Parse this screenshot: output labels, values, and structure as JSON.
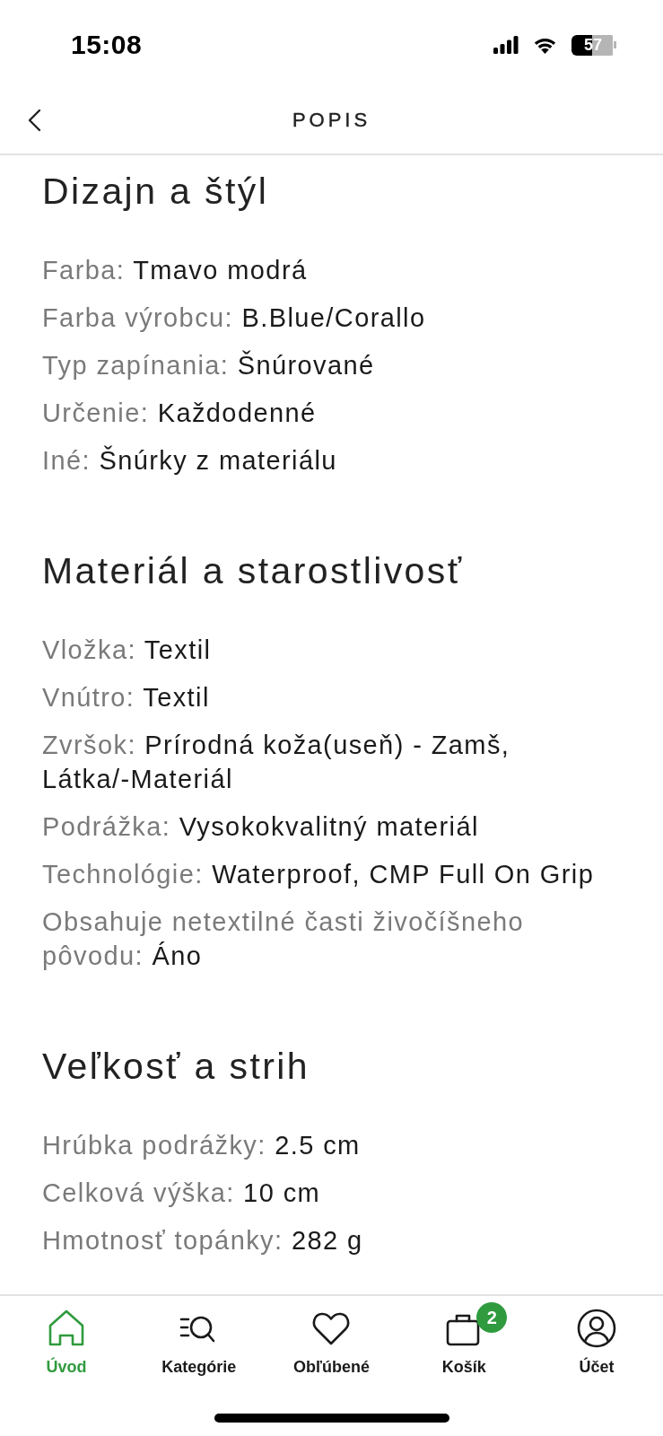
{
  "status_bar": {
    "time": "15:08",
    "battery": "57"
  },
  "header": {
    "title": "POPIS"
  },
  "sections": [
    {
      "title": "Dizajn a štýl",
      "attributes": [
        {
          "label": "Farba:",
          "value": "Tmavo modrá"
        },
        {
          "label": "Farba výrobcu:",
          "value": "B.Blue/Corallo"
        },
        {
          "label": "Typ zapínania:",
          "value": "Šnúrované"
        },
        {
          "label": "Určenie:",
          "value": "Každodenné"
        },
        {
          "label": "Iné:",
          "value": "Šnúrky z materiálu"
        }
      ]
    },
    {
      "title": "Materiál a starostlivosť",
      "attributes": [
        {
          "label": "Vložka:",
          "value": "Textil"
        },
        {
          "label": "Vnútro:",
          "value": "Textil"
        },
        {
          "label": "Zvršok:",
          "value": "Prírodná koža(useň) - Zamš, Látka/-Materiál"
        },
        {
          "label": "Podrážka:",
          "value": "Vysokokvalitný materiál"
        },
        {
          "label": "Technológie:",
          "value": "Waterproof, CMP Full On Grip"
        },
        {
          "label": "Obsahuje netextilné časti živočíšneho pôvodu:",
          "value": "Áno"
        }
      ]
    },
    {
      "title": "Veľkosť a strih",
      "attributes": [
        {
          "label": "Hrúbka podrážky:",
          "value": "2.5 cm"
        },
        {
          "label": "Celková výška:",
          "value": "10 cm"
        },
        {
          "label": "Hmotnosť topánky:",
          "value": "282 g"
        }
      ]
    }
  ],
  "tab_bar": [
    {
      "kind": "home",
      "label": "Úvod",
      "selected": true
    },
    {
      "kind": "categories",
      "label": "Kategórie",
      "selected": false
    },
    {
      "kind": "favorites",
      "label": "Obľúbené",
      "selected": false
    },
    {
      "kind": "cart",
      "label": "Košík",
      "selected": false,
      "badge": "2"
    },
    {
      "kind": "account",
      "label": "Účet",
      "selected": false
    }
  ]
}
